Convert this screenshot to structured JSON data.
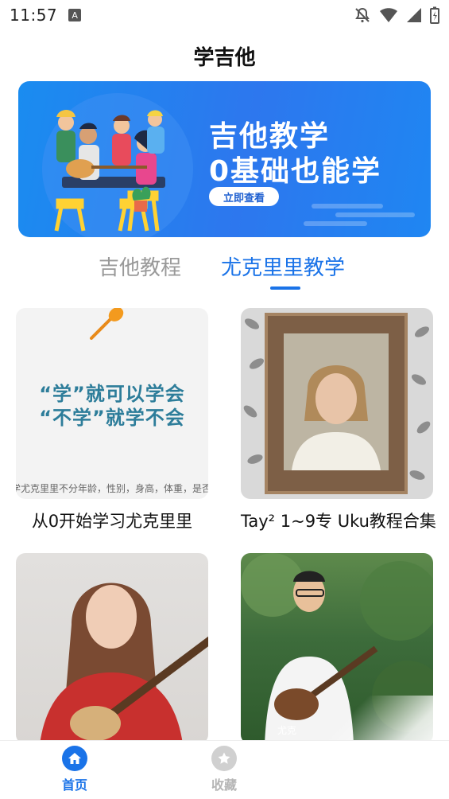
{
  "status_bar": {
    "time": "11:57",
    "badge": "A",
    "icons": [
      "mute-icon",
      "wifi-icon",
      "signal-icon",
      "battery-icon"
    ]
  },
  "header": {
    "title": "学吉他"
  },
  "banner": {
    "line1": "吉他教学",
    "line2": "0基础也能学",
    "button_label": "立即查看"
  },
  "tabs": [
    {
      "label": "吉他教程",
      "active": false
    },
    {
      "label": "尤克里里教学",
      "active": true
    }
  ],
  "cards": [
    {
      "title": "从0开始学习尤克里里",
      "thumb_line1": "“学”就可以学会",
      "thumb_line2": "“不学”就学不会",
      "thumb_footer": "学尤克里里不分年龄，性别，身高，体重，是否有基"
    },
    {
      "title": "Tay² 1~9专 Uku教程合集"
    },
    {
      "title": ""
    },
    {
      "title": "",
      "thumb_caption": "尤克"
    }
  ],
  "bottom_nav": [
    {
      "label": "首页",
      "icon": "home-icon",
      "active": true
    },
    {
      "label": "收藏",
      "icon": "star-icon",
      "active": false
    }
  ],
  "colors": {
    "accent": "#1a73e8",
    "inactive_tab": "#999999",
    "banner_bg": "#2d77ee"
  }
}
